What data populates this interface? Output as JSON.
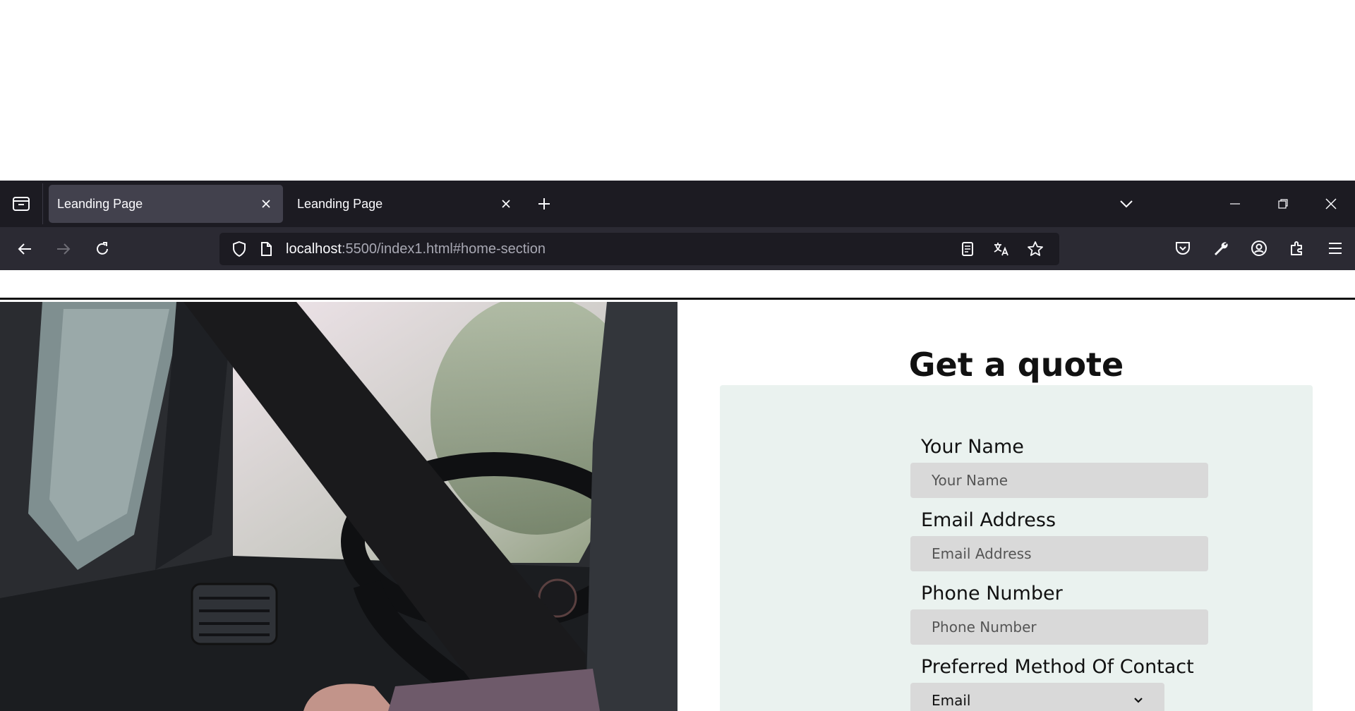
{
  "browser": {
    "tabs": [
      {
        "title": "Leanding Page",
        "active": true
      },
      {
        "title": "Leanding Page",
        "active": false
      }
    ],
    "url": {
      "host": "localhost",
      "path": ":5500/index1.html#home-section"
    }
  },
  "page": {
    "quote_title": "Get a quote",
    "form": {
      "name_label": "Your Name",
      "name_placeholder": "Your Name",
      "email_label": "Email Address",
      "email_placeholder": "Email Address",
      "phone_label": "Phone Number",
      "phone_placeholder": "Phone Number",
      "contact_label": "Preferred Method Of Contact",
      "contact_selected": "Email"
    }
  },
  "colors": {
    "tabbar_bg": "#1c1b22",
    "navbar_bg": "#2b2a33",
    "card_bg": "#eaf2ef",
    "input_bg": "#d9d9d9"
  }
}
